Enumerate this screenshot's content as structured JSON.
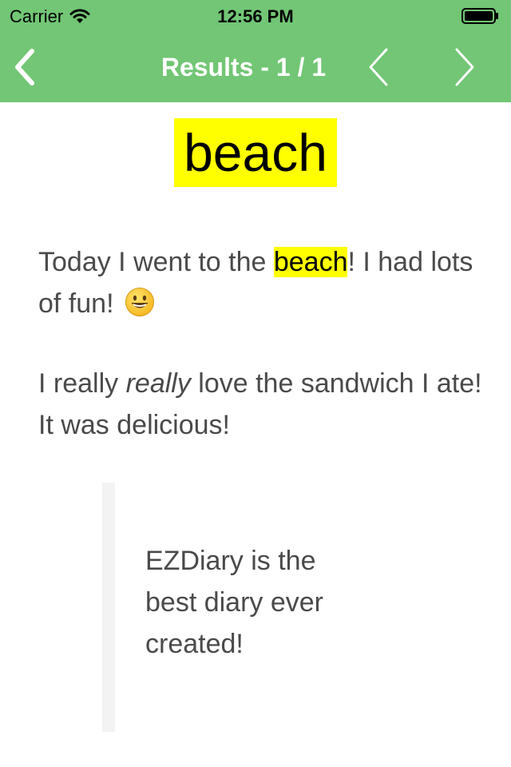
{
  "status_bar": {
    "carrier": "Carrier",
    "time": "12:56 PM",
    "wifi_icon": "wifi-icon",
    "battery_icon": "battery-icon"
  },
  "nav": {
    "title": "Results - 1 / 1",
    "back_icon": "chevron-left-icon",
    "prev_icon": "chevron-left-thin-icon",
    "next_icon": "chevron-right-thin-icon"
  },
  "search": {
    "term": "beach"
  },
  "entry": {
    "p1_before": "Today I went to the ",
    "p1_highlight": "beach",
    "p1_after": "! I had lots of fun! ",
    "p1_emoji": "grinning-face-emoji",
    "p2_before": "I really ",
    "p2_emphasis": "really",
    "p2_after": " love the sandwich I ate! It was delicious!",
    "quote": "EZDiary is the best diary ever created!"
  },
  "colors": {
    "header": "#72c675",
    "highlight": "#ffff00",
    "body_text": "#4a4a4a",
    "quote_bar": "#f3f3f3"
  }
}
